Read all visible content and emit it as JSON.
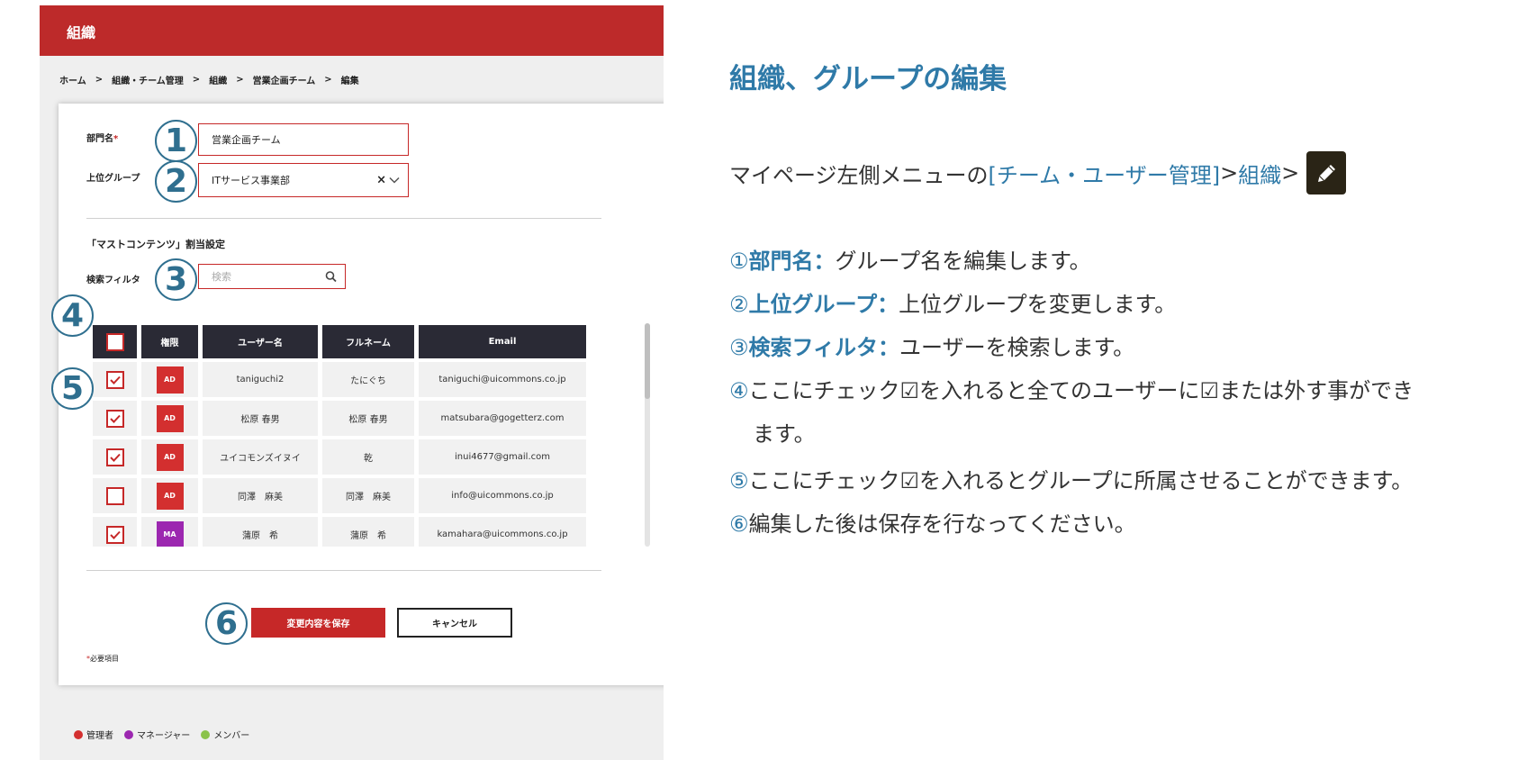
{
  "screenshot": {
    "header_title": "組織",
    "breadcrumb": [
      "ホーム",
      "組織・チーム管理",
      "組織",
      "営業企画チーム",
      "編集"
    ],
    "breadcrumb_sep": ">",
    "form": {
      "dept_label": "部門名",
      "required_mark": "*",
      "dept_value": "営業企画チーム",
      "parent_label": "上位グループ",
      "parent_value": "ITサービス事業部",
      "clear_icon": "×",
      "section_title": "「マストコンテンツ」割当設定",
      "filter_label": "検索フィルタ",
      "filter_placeholder": "検索"
    },
    "table": {
      "headers": [
        "権限",
        "ユーザー名",
        "フルネーム",
        "Email"
      ],
      "rows": [
        {
          "checked": true,
          "role": "AD",
          "username": "taniguchi2",
          "fullname": "たにぐち",
          "email": "taniguchi@uicommons.co.jp"
        },
        {
          "checked": true,
          "role": "AD",
          "username": "松原 春男",
          "fullname": "松原 春男",
          "email": "matsubara@gogetterz.com"
        },
        {
          "checked": true,
          "role": "AD",
          "username": "ユイコモンズイヌイ",
          "fullname": "乾",
          "email": "inui4677@gmail.com"
        },
        {
          "checked": false,
          "role": "AD",
          "username": "同澤　麻美",
          "fullname": "同澤　麻美",
          "email": "info@uicommons.co.jp"
        },
        {
          "checked": true,
          "role": "MA",
          "username": "蒲原　希",
          "fullname": "蒲原　希",
          "email": "kamahara@uicommons.co.jp"
        }
      ]
    },
    "buttons": {
      "save": "変更内容を保存",
      "cancel": "キャンセル"
    },
    "required_note": "必要項目",
    "legend": [
      {
        "label": "管理者",
        "color": "#d32f2f"
      },
      {
        "label": "マネージャー",
        "color": "#9c27b0"
      },
      {
        "label": "メンバー",
        "color": "#8bc34a"
      }
    ],
    "markers": [
      "1",
      "2",
      "3",
      "4",
      "5",
      "6"
    ],
    "colors": {
      "header": "#bd2a2a",
      "accent": "#c62828",
      "role_ad": "#d32f2f",
      "role_ma": "#9c27b0",
      "table_head": "#2a2a35",
      "marker": "#2f6f8f"
    }
  },
  "guide": {
    "title": "組織、グループの編集",
    "nav": {
      "prefix": "マイページ左側メニューの",
      "link1": "[チーム・ユーザー管理]",
      "sep1": " > ",
      "link2": "組織",
      "sep2": " > "
    },
    "steps": [
      {
        "num": "①",
        "key": "部門名：",
        "text": "グループ名を編集します。"
      },
      {
        "num": "②",
        "key": "上位グループ：",
        "text": "上位グループを変更します。"
      },
      {
        "num": "③",
        "key": "検索フィルタ：",
        "text": "ユーザーを検索します。"
      },
      {
        "num": "④",
        "key": "",
        "text": "ここにチェック☑を入れると全てのユーザーに☑または外す事ができ"
      },
      {
        "num": "",
        "key": "",
        "text": "ます。"
      },
      {
        "num": "⑤",
        "key": "",
        "text": "ここにチェック☑を入れるとグループに所属させることができます。"
      },
      {
        "num": "⑥",
        "key": "",
        "text": "編集した後は保存を行なってください。"
      }
    ],
    "colors": {
      "title": "#2f7aa8",
      "text": "#333333"
    },
    "icons": {
      "edit": "pencil-icon"
    }
  }
}
